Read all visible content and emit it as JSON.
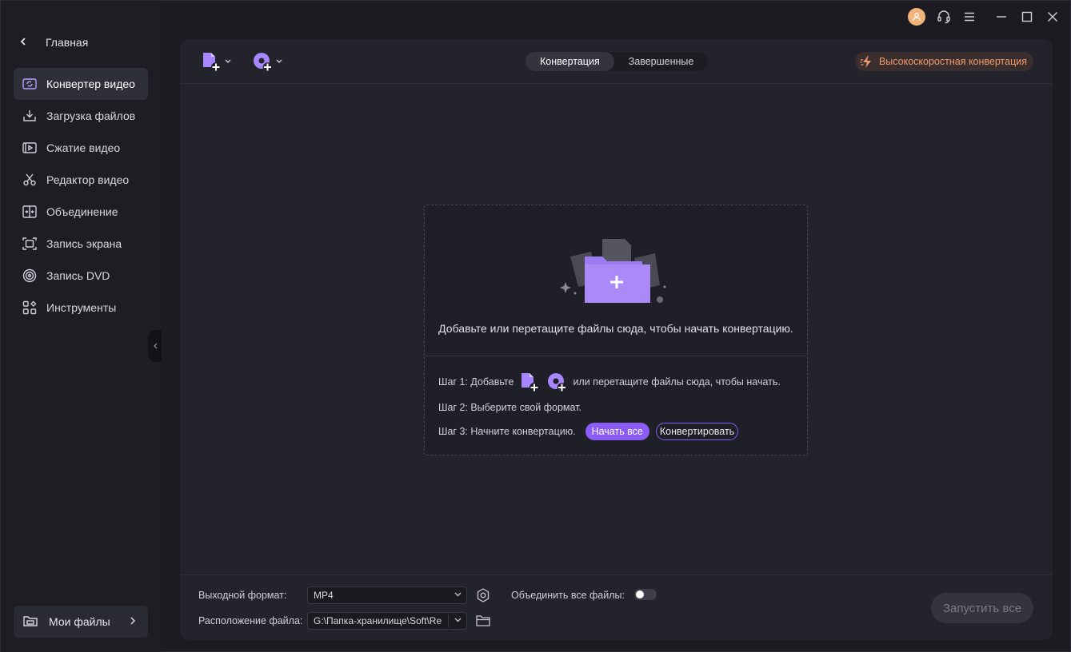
{
  "sidebar": {
    "home_label": "Главная",
    "items": [
      {
        "label": "Конвертер видео",
        "icon": "video-converter-icon",
        "active": true
      },
      {
        "label": "Загрузка файлов",
        "icon": "download-icon"
      },
      {
        "label": "Сжатие видео",
        "icon": "compress-icon"
      },
      {
        "label": "Редактор видео",
        "icon": "scissors-icon"
      },
      {
        "label": "Объединение",
        "icon": "merge-icon"
      },
      {
        "label": "Запись экрана",
        "icon": "screen-record-icon"
      },
      {
        "label": "Запись DVD",
        "icon": "dvd-icon"
      },
      {
        "label": "Инструменты",
        "icon": "tools-grid-icon"
      }
    ],
    "my_files_label": "Мои файлы"
  },
  "toolbar": {
    "tabs": [
      {
        "label": "Конвертация",
        "active": true
      },
      {
        "label": "Завершенные",
        "active": false
      }
    ],
    "fast_conversion_label": "Высокоскоростная конвертация"
  },
  "dropzone": {
    "main_text": "Добавьте или перетащите файлы сюда, чтобы начать конвертацию.",
    "step1_prefix": "Шаг 1: Добавьте",
    "step1_suffix": "или перетащите файлы сюда, чтобы начать.",
    "step2": "Шаг 2: Выберите свой формат.",
    "step3": "Шаг 3: Начните конвертацию.",
    "start_all_label": "Начать все",
    "convert_label": "Конвертировать"
  },
  "bottombar": {
    "output_format_label": "Выходной формат:",
    "output_format_value": "MP4",
    "merge_label": "Объединить все файлы:",
    "merge_enabled": false,
    "location_label": "Расположение файла:",
    "location_value": "G:\\Папка-хранилище\\Soft\\Re",
    "run_all_label": "Запустить все"
  },
  "colors": {
    "accent": "#8b5cf6",
    "fast_conversion": "#f19a6c",
    "avatar": "#f2b37a"
  }
}
